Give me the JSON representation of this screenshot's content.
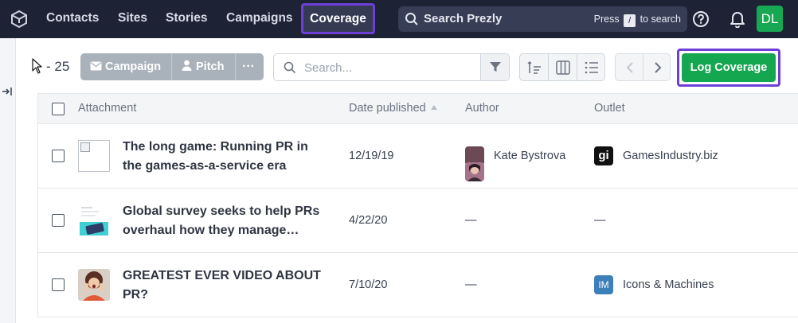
{
  "nav": {
    "items": [
      "Contacts",
      "Sites",
      "Stories",
      "Campaigns"
    ],
    "active": "Coverage",
    "search_label": "Search Prezly",
    "search_hint_press": "Press",
    "search_hint_key": "/",
    "search_hint_suffix": "to search",
    "avatar_initials": "DL"
  },
  "toolbar": {
    "count": "- 25",
    "campaign_label": "Campaign",
    "pitch_label": "Pitch",
    "more_label": "···",
    "search_placeholder": "Search...",
    "log_coverage_label": "Log Coverage"
  },
  "table": {
    "columns": [
      "Attachment",
      "Date published",
      "Author",
      "Outlet"
    ],
    "rows": [
      {
        "title_line1": "The long game: Running PR in",
        "title_line2": "the games-as-a-service era",
        "date": "12/19/19",
        "author": "Kate Bystrova",
        "outlet": "GamesIndustry.biz",
        "outlet_logo": "gi"
      },
      {
        "title_line1": "Global survey seeks to help PRs",
        "title_line2": "overhaul how they manage…",
        "date": "4/22/20",
        "author": "—",
        "outlet": "—",
        "outlet_logo": ""
      },
      {
        "title_line1": "GREATEST EVER VIDEO ABOUT",
        "title_line2": "PR?",
        "date": "7/10/20",
        "author": "—",
        "outlet": "Icons & Machines",
        "outlet_logo": "IM"
      }
    ]
  },
  "colors": {
    "nav_bg": "#1e2235",
    "accent": "#6d3fd6",
    "primary_green": "#15a650"
  }
}
